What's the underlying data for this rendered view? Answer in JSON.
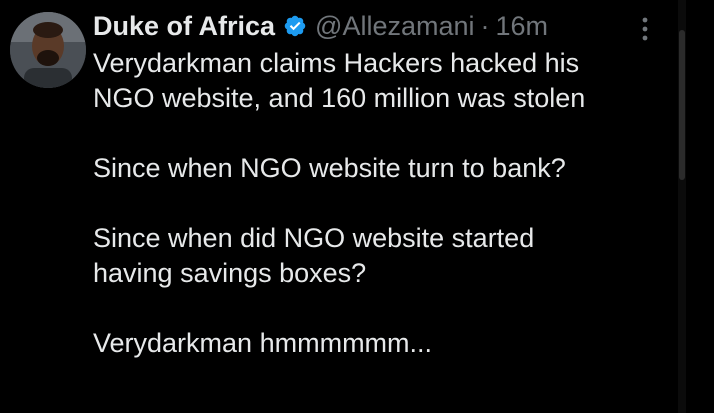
{
  "tweet": {
    "author": {
      "display_name": "Duke of Africa",
      "handle": "@Allezamani",
      "verified": true,
      "avatar_icon": "avatar"
    },
    "separator": "·",
    "time": "16m",
    "more_icon": "more-vertical-icon",
    "text": {
      "p1_line1": "Verydarkman claims Hackers hacked his",
      "p1_line2": "NGO website, and 160 million was stolen",
      "p2": "Since when NGO website turn to bank?",
      "p3_line1": "Since when did NGO website started",
      "p3_line2": "having savings boxes?",
      "p4": "Verydarkman hmmmmmm..."
    }
  },
  "colors": {
    "background": "#000000",
    "primary_text": "#e7e9ea",
    "secondary_text": "#71767b",
    "verified_badge": "#1d9bf0"
  }
}
